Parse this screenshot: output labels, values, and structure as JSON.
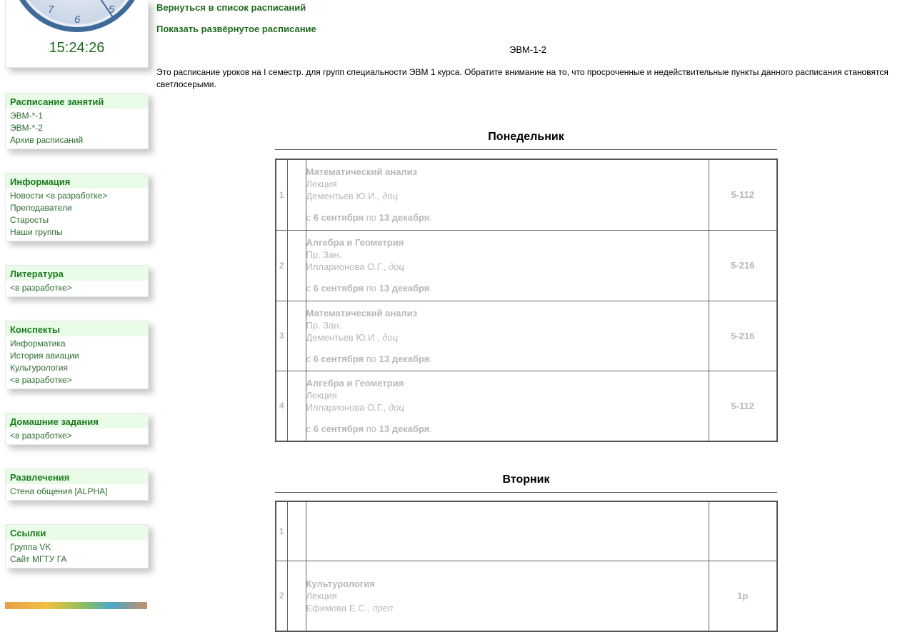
{
  "clock": {
    "time": "15:24:26",
    "numerals": [
      "7",
      "6",
      "5"
    ]
  },
  "sidebar": {
    "blocks": [
      {
        "title": "Расписание занятий",
        "items": [
          "ЭВМ-*-1",
          "ЭВМ-*-2",
          "Архив расписаний"
        ]
      },
      {
        "title": "Информация",
        "items": [
          "Новости <в разработке>",
          "Преподаватели",
          "Старосты",
          "Наши группы"
        ]
      },
      {
        "title": "Литература",
        "items": [
          "<в разработке>"
        ]
      },
      {
        "title": "Конспекты",
        "items": [
          "Информатика",
          "История авиации",
          "Культурология",
          "<в разработке>"
        ]
      },
      {
        "title": "Домашние задания",
        "items": [
          "<в разработке>"
        ]
      },
      {
        "title": "Развлечения",
        "items": [
          "Стена общения [ALPHA]"
        ]
      },
      {
        "title": "Ссылки",
        "items": [
          "Группа VK",
          "Сайт МГТУ ГА"
        ]
      }
    ]
  },
  "main": {
    "back_link": "Вернуться в список расписаний",
    "expand_link": "Показать развёрнутое расписание",
    "group_name": "ЭВМ-1-2",
    "description": "Это расписание уроков на I семестр. для групп специальности ЭВМ 1 курса. Обратите внимание на то, что просроченные и недействительные пункты данного расписания становятся светлосерыми.",
    "period_prefix": "с",
    "period_mid": "по",
    "days": [
      {
        "name": "Понедельник",
        "lessons": [
          {
            "num": "1",
            "subject": "Математический анализ",
            "type": "Лекция",
            "teacher": "Дементьев Ю.И.,",
            "role": "доц",
            "from": "6 сентября",
            "to": "13 декабря",
            "room": "5-112"
          },
          {
            "num": "2",
            "subject": "Алгебра и Геометрия",
            "type": "Пр. Зан.",
            "teacher": "Илларионова О.Г.,",
            "role": "доц",
            "from": "6 сентября",
            "to": "13 декабря",
            "room": "5-216"
          },
          {
            "num": "3",
            "subject": "Математический анализ",
            "type": "Пр. Зан.",
            "teacher": "Дементьев Ю.И.,",
            "role": "доц",
            "from": "6 сентября",
            "to": "13 декабря",
            "room": "5-216"
          },
          {
            "num": "4",
            "subject": "Алгебра и Геометрия",
            "type": "Лекция",
            "teacher": "Илларионова О.Г.,",
            "role": "доц",
            "from": "6 сентября",
            "to": "13 декабря",
            "room": "5-112"
          }
        ]
      },
      {
        "name": "Вторник",
        "lessons": [
          {
            "num": "1",
            "subject": "",
            "type": "",
            "teacher": "",
            "role": "",
            "from": "",
            "to": "",
            "room": ""
          },
          {
            "num": "2",
            "subject": "Культурология",
            "type": "Лекция",
            "teacher": "Ефимова Е.С.,",
            "role": "преп",
            "from": "",
            "to": "",
            "room": "1р"
          }
        ]
      }
    ]
  }
}
